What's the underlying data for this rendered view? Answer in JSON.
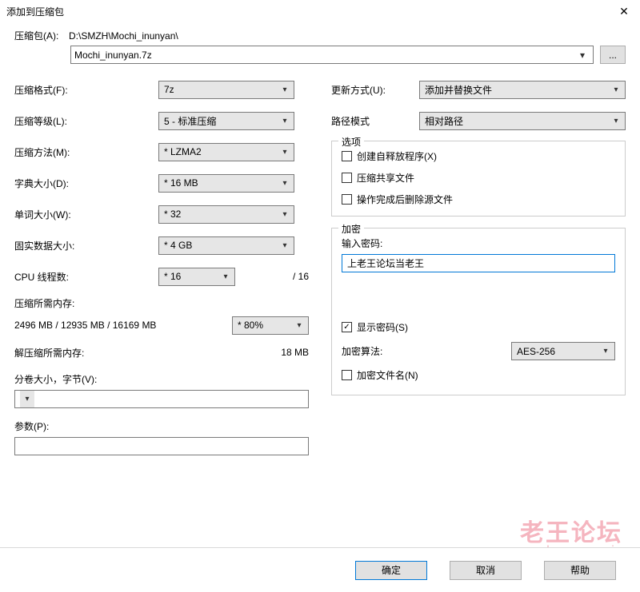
{
  "window": {
    "title": "添加到压缩包"
  },
  "path": {
    "label": "压缩包(A):",
    "dir": "D:\\SMZH\\Mochi_inunyan\\",
    "archive": "Mochi_inunyan.7z",
    "browse": "..."
  },
  "left": {
    "format_label": "压缩格式(F):",
    "format_value": "7z",
    "level_label": "压缩等级(L):",
    "level_value": "5 - 标准压缩",
    "method_label": "压缩方法(M):",
    "method_value": "* LZMA2",
    "dict_label": "字典大小(D):",
    "dict_value": "* 16 MB",
    "word_label": "单词大小(W):",
    "word_value": "* 32",
    "solid_label": "固实数据大小:",
    "solid_value": "* 4 GB",
    "threads_label": "CPU 线程数:",
    "threads_value": "* 16",
    "threads_suffix": "/ 16",
    "mem_compress_label": "压缩所需内存:",
    "mem_compress_value": "2496 MB / 12935 MB / 16169 MB",
    "mem_pct_value": "* 80%",
    "mem_decompress_label": "解压缩所需内存:",
    "mem_decompress_value": "18 MB",
    "split_label": "分卷大小，字节(V):",
    "params_label": "参数(P):"
  },
  "right": {
    "update_label": "更新方式(U):",
    "update_value": "添加并替换文件",
    "pathmode_label": "路径模式",
    "pathmode_value": "相对路径",
    "options_legend": "选项",
    "opt_sfx": "创建自释放程序(X)",
    "opt_share": "压缩共享文件",
    "opt_delete": "操作完成后删除源文件",
    "encrypt_legend": "加密",
    "pwd_label": "输入密码:",
    "pwd_value": "上老王论坛当老王",
    "show_pwd": "显示密码(S)",
    "enc_method_label": "加密算法:",
    "enc_method_value": "AES-256",
    "enc_names": "加密文件名(N)"
  },
  "footer": {
    "ok": "确定",
    "cancel": "取消",
    "help": "帮助"
  },
  "watermark": {
    "line1": "老王论坛",
    "line2": "laowang.vip"
  }
}
